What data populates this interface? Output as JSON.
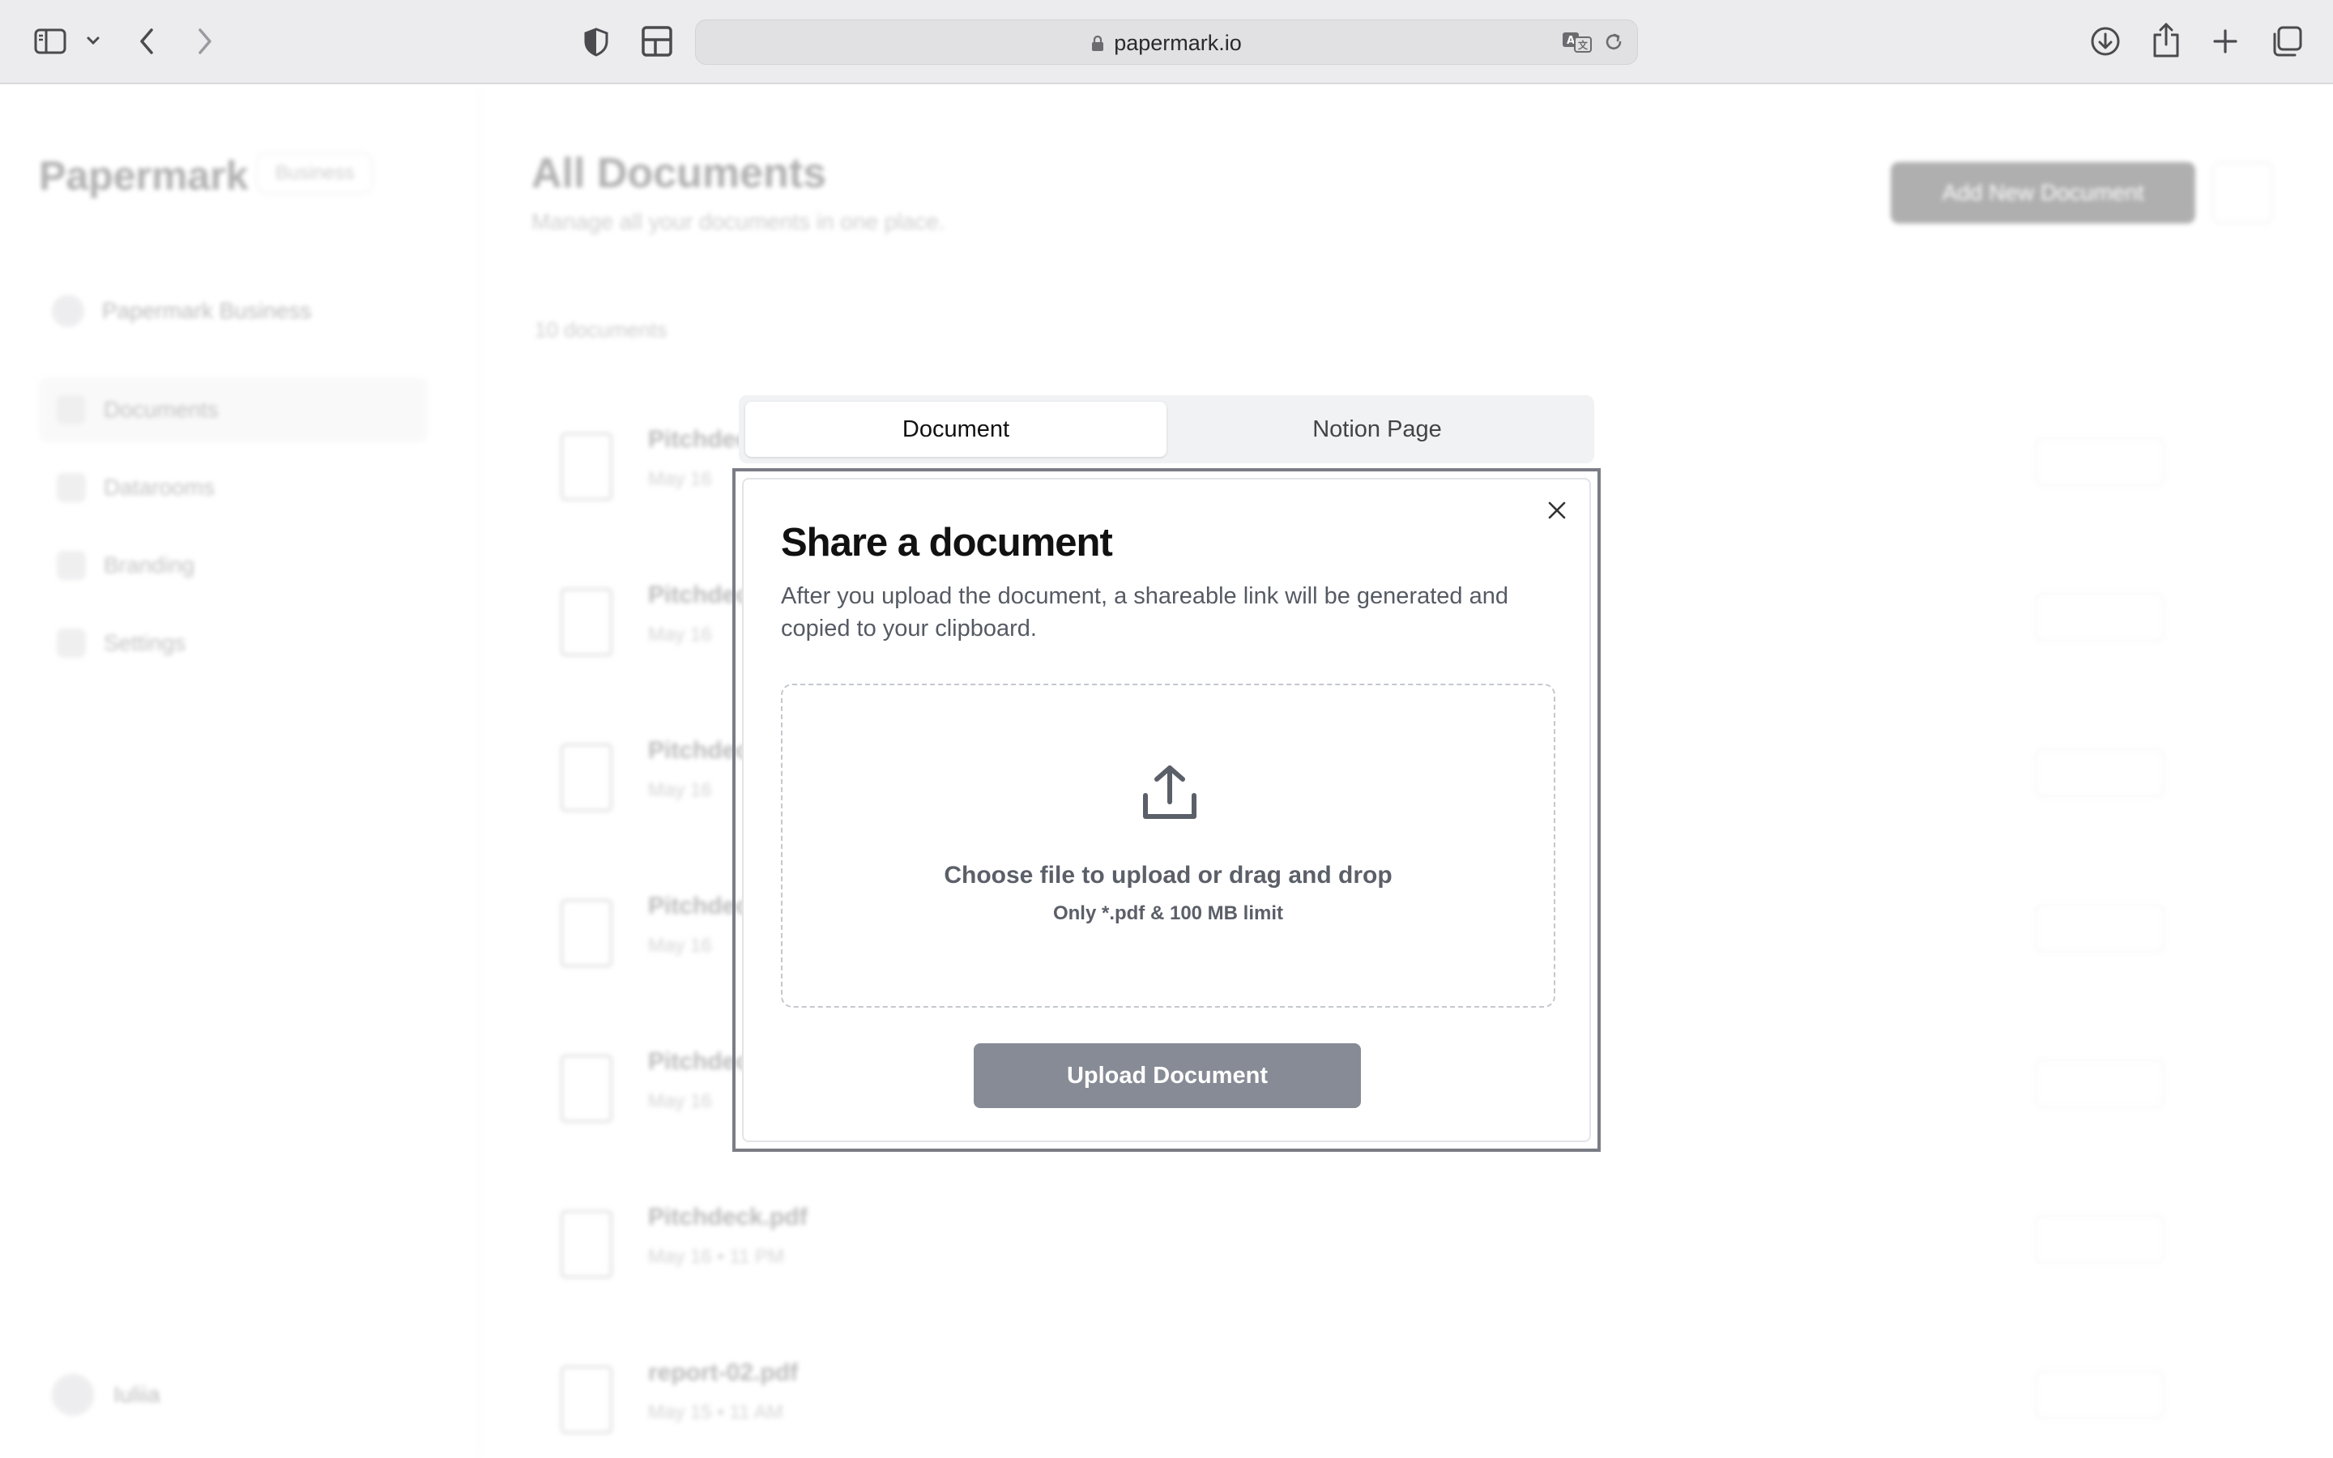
{
  "browser": {
    "url": "papermark.io"
  },
  "app": {
    "brand": "Papermark",
    "brand_badge": "Business",
    "team": "Papermark Business",
    "nav": [
      "Documents",
      "Datarooms",
      "Branding",
      "Settings"
    ],
    "user": "Iuliia",
    "title": "All Documents",
    "subtitle": "Manage all your documents in one place.",
    "add_button": "Add New Document",
    "count": "10 documents",
    "documents": [
      {
        "name": "Pitchdeck",
        "date": "May 16"
      },
      {
        "name": "Pitchdeck",
        "date": "May 16"
      },
      {
        "name": "Pitchdeck",
        "date": "May 16"
      },
      {
        "name": "Pitchdeck",
        "date": "May 16"
      },
      {
        "name": "Pitchdeck",
        "date": "May 16"
      },
      {
        "name": "Pitchdeck.pdf",
        "date": "May 16 • 11 PM"
      },
      {
        "name": "report-02.pdf",
        "date": "May 15 • 11 AM"
      }
    ]
  },
  "tabs": [
    {
      "label": "Document",
      "active": true
    },
    {
      "label": "Notion Page",
      "active": false
    }
  ],
  "modal": {
    "title": "Share a document",
    "description": "After you upload the document, a shareable link will be generated and copied to your clipboard.",
    "drop_main": "Choose file to upload or drag and drop",
    "drop_sub": "Only *.pdf & 100 MB limit",
    "upload_button": "Upload Document"
  },
  "icons": {
    "sidebar": "sidebar-icon",
    "back": "chevron-left-icon",
    "forward": "chevron-right-icon",
    "shield": "privacy-shield-icon",
    "layout": "layout-icon",
    "lock": "lock-icon",
    "translate": "translate-icon",
    "reload": "reload-icon",
    "download": "download-icon",
    "share": "share-icon",
    "new_tab": "plus-icon",
    "tabs": "tabs-overview-icon",
    "close": "close-icon",
    "upload": "upload-icon"
  }
}
